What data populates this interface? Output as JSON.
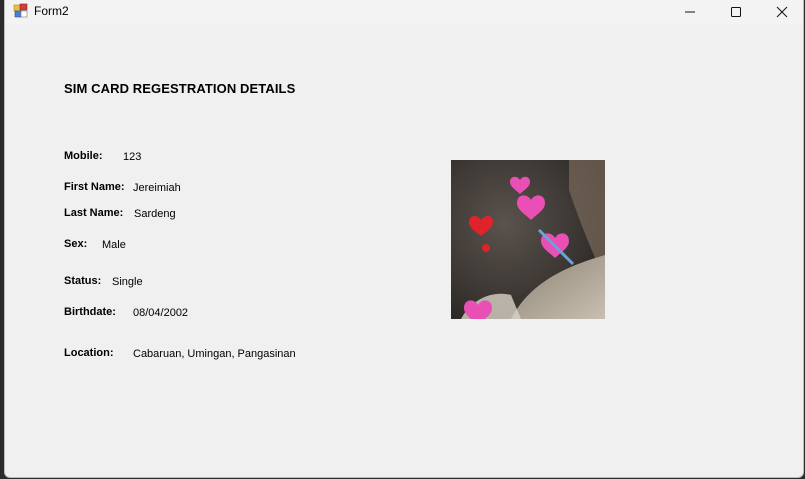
{
  "window": {
    "title": "Form2",
    "minimize_icon": "minimize-icon",
    "maximize_icon": "maximize-icon",
    "close_icon": "close-icon"
  },
  "form": {
    "heading": "SIM CARD REGESTRATION DETAILS",
    "fields": {
      "mobile": {
        "label": "Mobile:",
        "value": "123"
      },
      "first_name": {
        "label": "First Name:",
        "value": "Jereimiah"
      },
      "last_name": {
        "label": "Last Name:",
        "value": "Sardeng"
      },
      "sex": {
        "label": "Sex:",
        "value": "Male"
      },
      "status": {
        "label": "Status:",
        "value": "Single"
      },
      "birthdate": {
        "label": "Birthdate:",
        "value": "08/04/2002"
      },
      "location": {
        "label": "Location:",
        "value": "Cabaruan, Umingan, Pangasinan"
      }
    },
    "photo": {
      "description_icon": "profile-photo"
    }
  },
  "colors": {
    "window_bg": "#f0f0f0",
    "titlebar_bg": "#f3f3f3",
    "heart_pink": "#e94fb5",
    "heart_red": "#e0222a"
  }
}
